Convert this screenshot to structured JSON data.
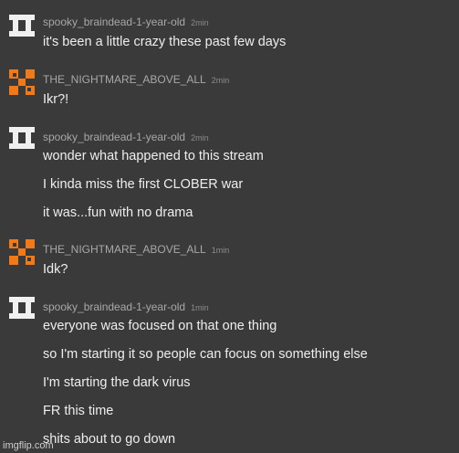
{
  "messages": [
    {
      "user": "spooky_braindead-1-year-old",
      "time": "2min",
      "avatar_icon": "white-block-avatar-icon",
      "avatar_color": "#f0f0f0",
      "lines": [
        "it's been a little crazy these past few days"
      ]
    },
    {
      "user": "THE_NIGHTMARE_ABOVE_ALL",
      "time": "2min",
      "avatar_icon": "orange-block-avatar-icon",
      "avatar_color": "#f07a1a",
      "lines": [
        "Ikr?!"
      ]
    },
    {
      "user": "spooky_braindead-1-year-old",
      "time": "2min",
      "avatar_icon": "white-block-avatar-icon",
      "avatar_color": "#f0f0f0",
      "lines": [
        "wonder what happened to this stream",
        "I kinda miss the first CLOBER war",
        "it was...fun with no drama"
      ]
    },
    {
      "user": "THE_NIGHTMARE_ABOVE_ALL",
      "time": "1min",
      "avatar_icon": "orange-block-avatar-icon",
      "avatar_color": "#f07a1a",
      "lines": [
        "Idk?"
      ]
    },
    {
      "user": "spooky_braindead-1-year-old",
      "time": "1min",
      "avatar_icon": "white-block-avatar-icon",
      "avatar_color": "#f0f0f0",
      "lines": [
        "everyone was focused on that one thing",
        "so I'm starting it so people can focus on something else",
        "I'm starting the dark virus",
        "FR this time",
        "shits about to go down"
      ]
    }
  ],
  "watermark": "imgflip.com",
  "colors": {
    "background": "#3a3a3a",
    "text": "#eeeeee",
    "meta": "#a8a8a8"
  }
}
